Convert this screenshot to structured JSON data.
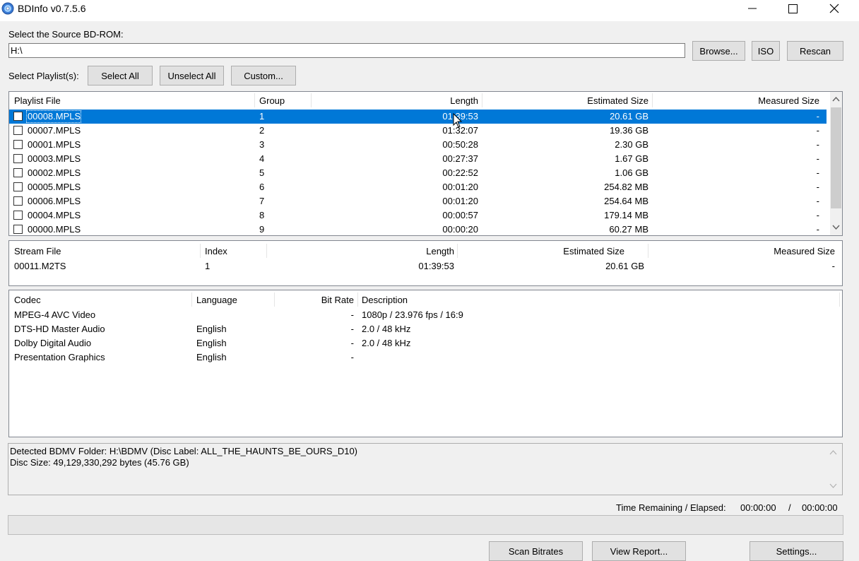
{
  "window": {
    "title": "BDInfo v0.7.5.6",
    "icon": "disc-icon"
  },
  "source": {
    "label": "Select the Source BD-ROM:",
    "path_value": "H:\\",
    "browse_label": "Browse...",
    "iso_label": "ISO",
    "rescan_label": "Rescan"
  },
  "playlists_bar": {
    "label": "Select Playlist(s):",
    "select_all": "Select All",
    "unselect_all": "Unselect All",
    "custom": "Custom..."
  },
  "playlist_table": {
    "headers": [
      "Playlist File",
      "Group",
      "Length",
      "Estimated Size",
      "Measured Size"
    ],
    "rows": [
      {
        "file": "00008.MPLS",
        "group": "1",
        "length": "01:39:53",
        "est": "20.61 GB",
        "measured": "-",
        "selected": true
      },
      {
        "file": "00007.MPLS",
        "group": "2",
        "length": "01:32:07",
        "est": "19.36 GB",
        "measured": "-"
      },
      {
        "file": "00001.MPLS",
        "group": "3",
        "length": "00:50:28",
        "est": "2.30 GB",
        "measured": "-"
      },
      {
        "file": "00003.MPLS",
        "group": "4",
        "length": "00:27:37",
        "est": "1.67 GB",
        "measured": "-"
      },
      {
        "file": "00002.MPLS",
        "group": "5",
        "length": "00:22:52",
        "est": "1.06 GB",
        "measured": "-"
      },
      {
        "file": "00005.MPLS",
        "group": "6",
        "length": "00:01:20",
        "est": "254.82 MB",
        "measured": "-"
      },
      {
        "file": "00006.MPLS",
        "group": "7",
        "length": "00:01:20",
        "est": "254.64 MB",
        "measured": "-"
      },
      {
        "file": "00004.MPLS",
        "group": "8",
        "length": "00:00:57",
        "est": "179.14 MB",
        "measured": "-"
      },
      {
        "file": "00000.MPLS",
        "group": "9",
        "length": "00:00:20",
        "est": "60.27 MB",
        "measured": "-"
      }
    ]
  },
  "stream_table": {
    "headers": [
      "Stream File",
      "Index",
      "Length",
      "Estimated Size",
      "Measured Size"
    ],
    "rows": [
      {
        "file": "00011.M2TS",
        "index": "1",
        "length": "01:39:53",
        "est": "20.61 GB",
        "measured": "-"
      }
    ]
  },
  "codec_table": {
    "headers": [
      "Codec",
      "Language",
      "Bit Rate",
      "Description"
    ],
    "rows": [
      {
        "codec": "MPEG-4 AVC Video",
        "language": "",
        "bitrate": "-",
        "desc": "1080p / 23.976 fps / 16:9"
      },
      {
        "codec": "DTS-HD Master Audio",
        "language": "English",
        "bitrate": "-",
        "desc": "2.0 / 48 kHz"
      },
      {
        "codec": "Dolby Digital Audio",
        "language": "English",
        "bitrate": "-",
        "desc": "2.0 / 48 kHz"
      },
      {
        "codec": "Presentation Graphics",
        "language": "English",
        "bitrate": "-",
        "desc": ""
      }
    ]
  },
  "status": {
    "line1": "Detected BDMV Folder: H:\\BDMV (Disc Label: ALL_THE_HAUNTS_BE_OURS_D10)",
    "line2": "Disc Size: 49,129,330,292 bytes (45.76 GB)"
  },
  "timing": {
    "label": "Time Remaining / Elapsed:",
    "remaining": "00:00:00",
    "divider": "/",
    "elapsed": "00:00:00"
  },
  "progress": {
    "value": 0
  },
  "buttons": {
    "scan_bitrates": "Scan Bitrates",
    "view_report": "View Report...",
    "settings": "Settings..."
  },
  "colors": {
    "selection": "#0078d7",
    "window_bg": "#f0f0f0"
  }
}
